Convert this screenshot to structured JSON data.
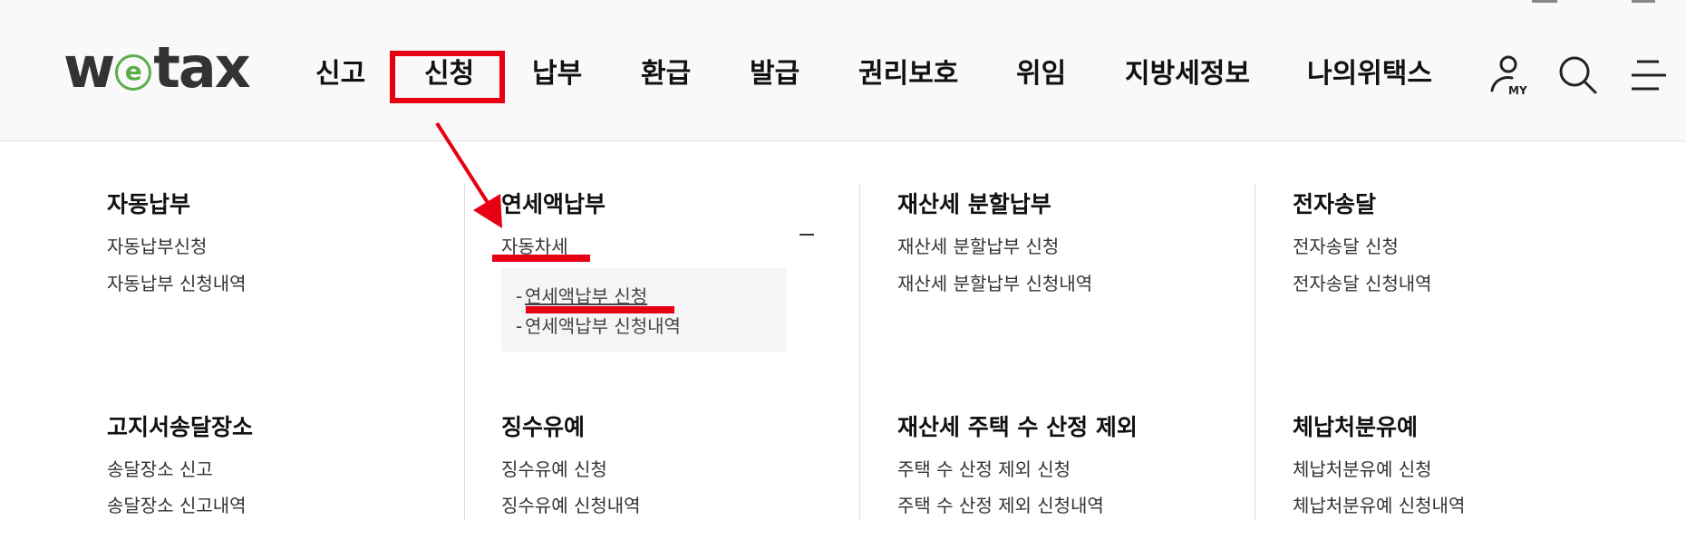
{
  "logo": {
    "prefix": "w",
    "middle": "e",
    "suffix": "tax"
  },
  "nav": [
    "신고",
    "신청",
    "납부",
    "환급",
    "발급",
    "권리보호",
    "위임",
    "지방세정보",
    "나의위택스"
  ],
  "icons": {
    "my_badge": "MY"
  },
  "menu": {
    "col1": {
      "title": "자동납부",
      "links": [
        "자동납부신청",
        "자동납부 신청내역"
      ],
      "title2": "고지서송달장소",
      "links2": [
        "송달장소 신고",
        "송달장소 신고내역"
      ]
    },
    "col2": {
      "title": "연세액납부",
      "links": [
        "자동차세"
      ],
      "sub": [
        "연세액납부 신청",
        "연세액납부 신청내역"
      ],
      "title2": "징수유예",
      "links2": [
        "징수유예 신청",
        "징수유예 신청내역"
      ]
    },
    "col3": {
      "title": "재산세 분할납부",
      "links": [
        "재산세 분할납부 신청",
        "재산세 분할납부 신청내역"
      ],
      "title2": "재산세 주택 수 산정 제외",
      "links2": [
        "주택 수 산정 제외 신청",
        "주택 수 산정 제외 신청내역"
      ]
    },
    "col4": {
      "title": "전자송달",
      "links": [
        "전자송달 신청",
        "전자송달 신청내역"
      ],
      "title2": "체납처분유예",
      "links2": [
        "체납처분유예 신청",
        "체납처분유예 신청내역"
      ]
    }
  },
  "colors": {
    "highlight": "#e60012",
    "logo_green": "#5cae4a"
  }
}
